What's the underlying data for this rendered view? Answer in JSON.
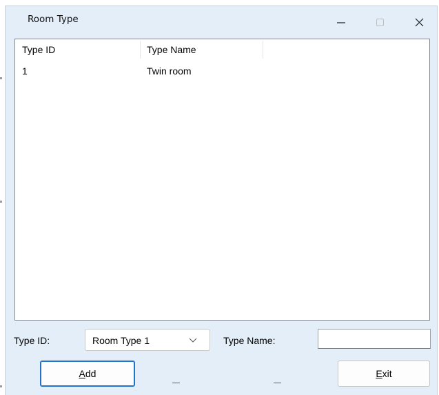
{
  "window": {
    "title": "Room Type",
    "controls": {
      "minimize_icon": "minimize-icon",
      "maximize_icon": "maximize-icon",
      "close_icon": "close-icon"
    }
  },
  "list": {
    "columns": [
      "Type ID",
      "Type Name",
      ""
    ],
    "rows": [
      [
        "1",
        "Twin room"
      ]
    ]
  },
  "form": {
    "type_id_label": "Type ID:",
    "type_id_selected": "Room Type 1",
    "type_name_label": "Type Name:",
    "type_name_value": ""
  },
  "buttons": {
    "add": {
      "mnemonic": "A",
      "rest": "dd"
    },
    "exit": {
      "mnemonic": "E",
      "rest": "xit"
    }
  },
  "colors": {
    "window_bg": "#e3eef8",
    "focus_accent": "#1f73c8"
  }
}
